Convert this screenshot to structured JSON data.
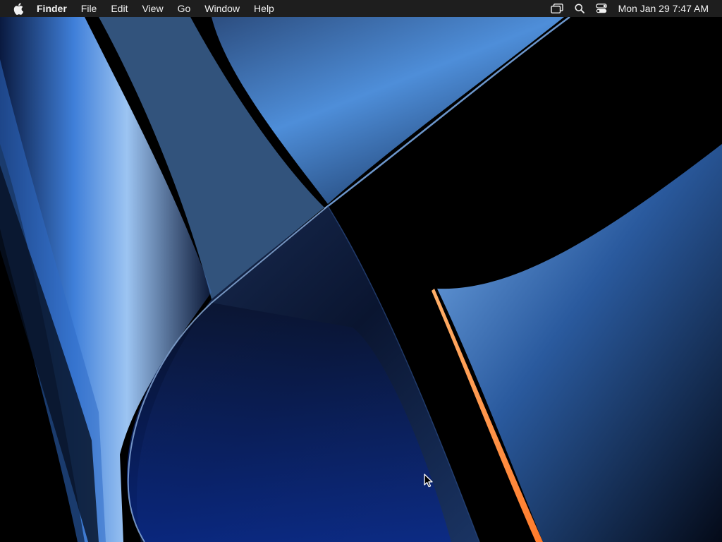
{
  "menubar": {
    "apple_icon": "apple-logo-icon",
    "app_name": "Finder",
    "menus": [
      "File",
      "Edit",
      "View",
      "Go",
      "Window",
      "Help"
    ],
    "status_icons": [
      "screen-mirroring-icon",
      "search-icon",
      "control-center-icon"
    ],
    "clock": "Mon Jan 29  7:47 AM"
  },
  "colors": {
    "menubar_bg": "#1e1e1e",
    "wallpaper_blue": "#3f7fd9",
    "wallpaper_dark": "#000000",
    "accent_orange": "#ff8a3d"
  }
}
